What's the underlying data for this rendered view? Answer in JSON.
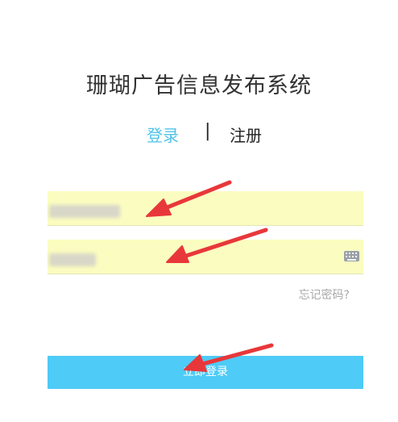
{
  "app": {
    "title": "珊瑚广告信息发布系统"
  },
  "tabs": {
    "login_label": "登录",
    "separator": "|",
    "register_label": "注册"
  },
  "form": {
    "forgot_label": "忘记密码?",
    "submit_label": "立即登录"
  },
  "colors": {
    "accent": "#4fc3e8",
    "button": "#4ecbf6",
    "field_bg": "#fafcc0",
    "annotation_arrow": "#e8373a"
  },
  "icons": {
    "password_field": "keyboard-icon"
  }
}
